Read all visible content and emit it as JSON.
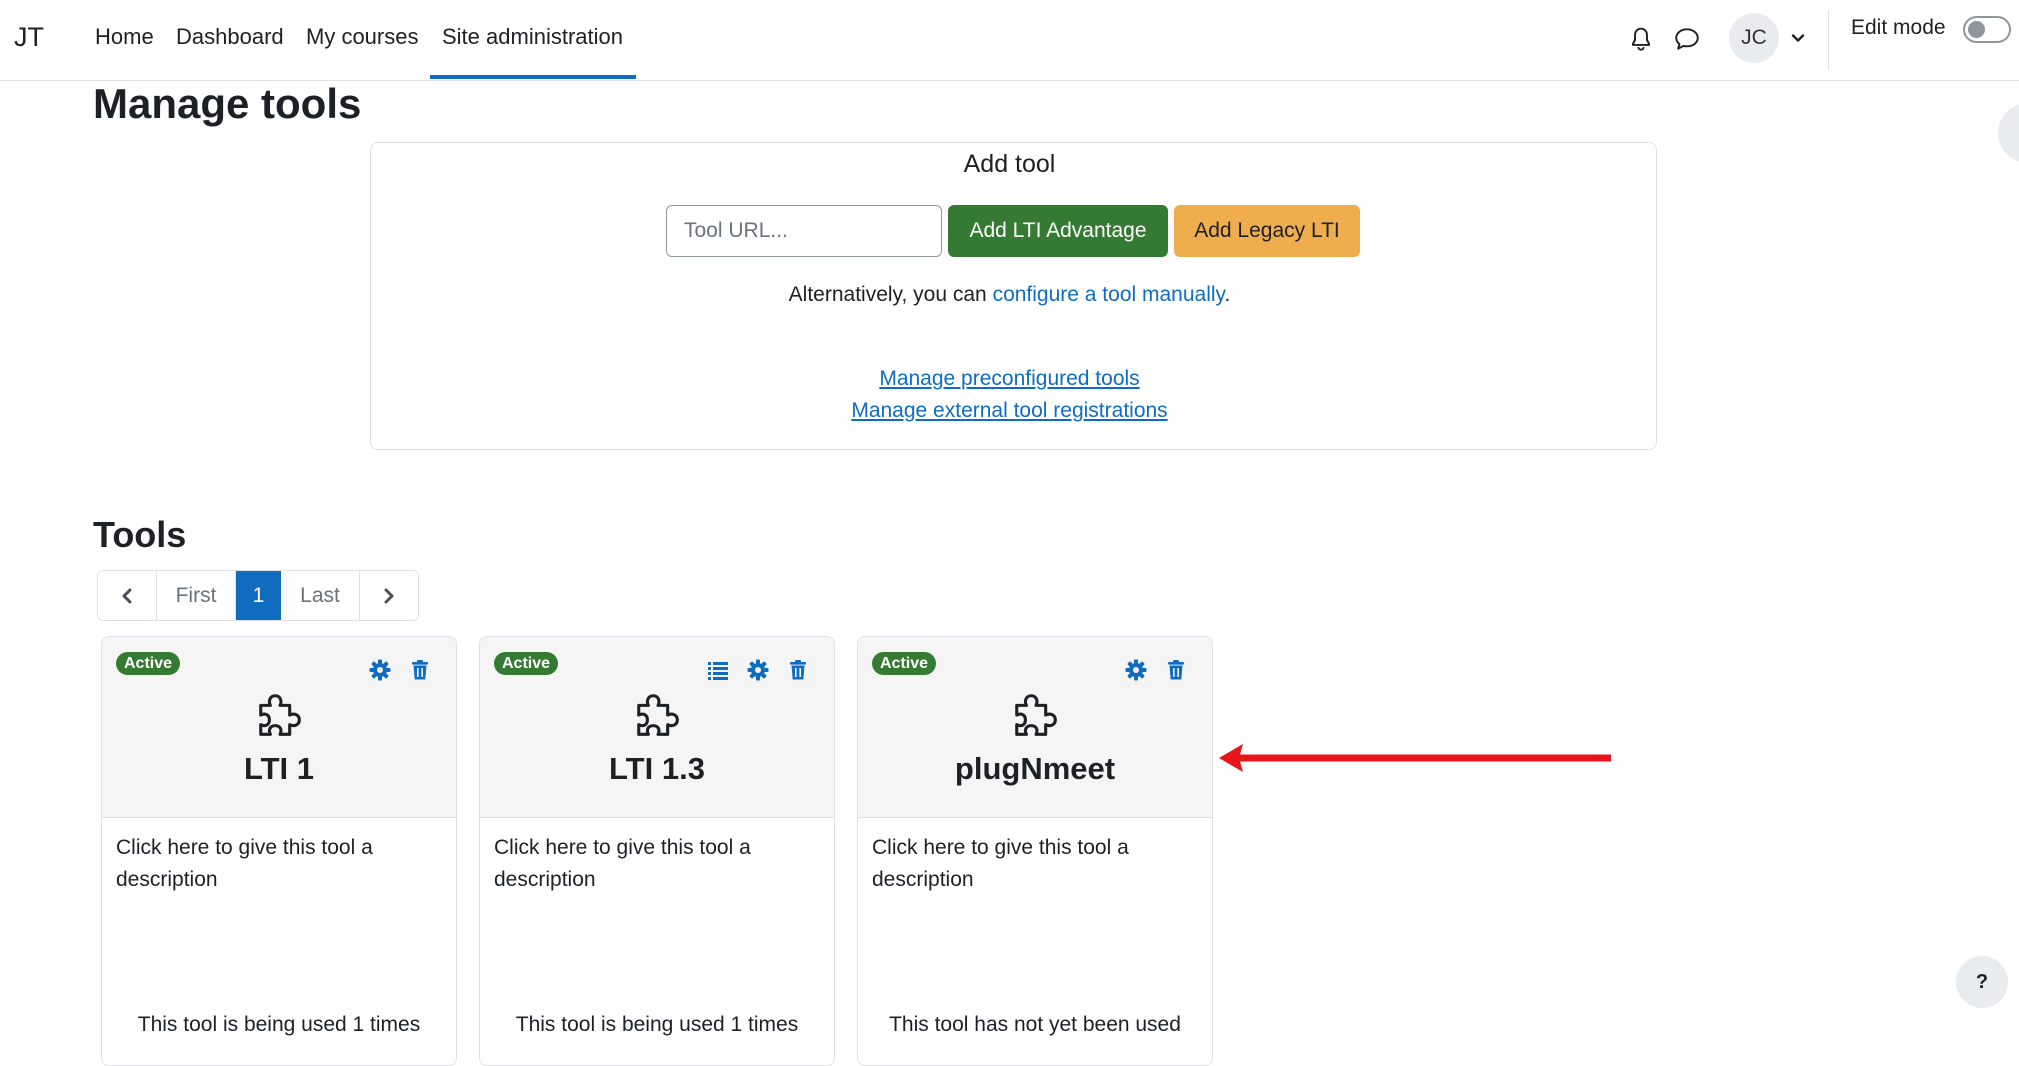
{
  "navbar": {
    "brand": "JT",
    "items": [
      {
        "label": "Home"
      },
      {
        "label": "Dashboard"
      },
      {
        "label": "My courses"
      },
      {
        "label": "Site administration"
      }
    ],
    "active_item": "Site administration",
    "user_initials": "JC",
    "edit_mode_label": "Edit mode",
    "edit_mode_on": false
  },
  "page": {
    "title": "Manage tools"
  },
  "add_tool": {
    "title": "Add tool",
    "url_placeholder": "Tool URL...",
    "url_value": "",
    "advantage_button": "Add LTI Advantage",
    "legacy_button": "Add Legacy LTI",
    "alt_prefix": "Alternatively, you can ",
    "alt_link": "configure a tool manually",
    "alt_suffix": ".",
    "link_preconfigured": "Manage preconfigured tools",
    "link_registrations": "Manage external tool registrations"
  },
  "tools": {
    "title": "Tools",
    "pagination": {
      "first": "First",
      "current": "1",
      "last": "Last"
    },
    "cards": [
      {
        "name": "LTI 1",
        "status": "Active",
        "description": "Click here to give this tool a description",
        "usage": "This tool is being used 1 times",
        "icons": [
          "gear-icon",
          "trash-icon"
        ]
      },
      {
        "name": "LTI 1.3",
        "status": "Active",
        "description": "Click here to give this tool a description",
        "usage": "This tool is being used 1 times",
        "icons": [
          "list-icon",
          "gear-icon",
          "trash-icon"
        ]
      },
      {
        "name": "plugNmeet",
        "status": "Active",
        "description": "Click here to give this tool a description",
        "usage": "This tool has not yet been used",
        "icons": [
          "gear-icon",
          "trash-icon"
        ]
      }
    ]
  },
  "help_button": "?",
  "colors": {
    "primary": "#0f6cbf",
    "success": "#357a32",
    "warning": "#f0ad4e",
    "annotation_arrow": "#e8141b"
  }
}
